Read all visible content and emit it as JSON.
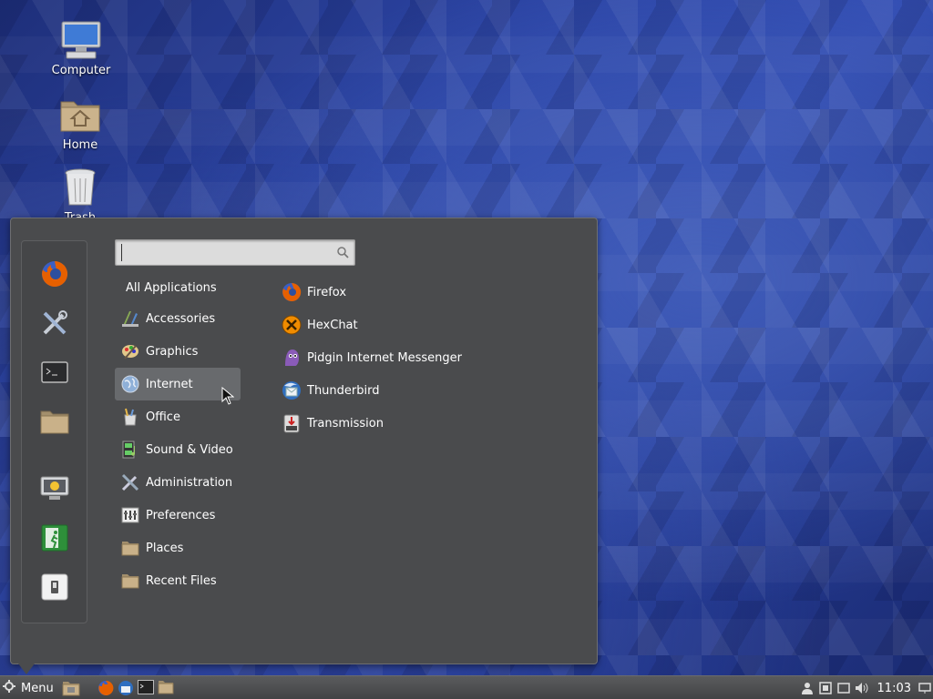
{
  "desktop": {
    "icons": [
      {
        "label": "Computer",
        "icon": "computer-icon"
      },
      {
        "label": "Home",
        "icon": "home-folder-icon"
      },
      {
        "label": "Trash",
        "icon": "trash-icon"
      }
    ]
  },
  "menu": {
    "search": {
      "placeholder": "",
      "value": ""
    },
    "favorites": [
      "firefox-icon",
      "system-settings-icon",
      "terminal-icon",
      "files-icon",
      "lock-screen-icon",
      "logout-icon",
      "shutdown-icon"
    ],
    "all_applications_label": "All Applications",
    "categories": [
      {
        "label": "Accessories",
        "icon": "accessories-icon"
      },
      {
        "label": "Graphics",
        "icon": "graphics-icon"
      },
      {
        "label": "Internet",
        "icon": "internet-icon",
        "selected": true
      },
      {
        "label": "Office",
        "icon": "office-icon"
      },
      {
        "label": "Sound & Video",
        "icon": "sound-video-icon"
      },
      {
        "label": "Administration",
        "icon": "administration-icon"
      },
      {
        "label": "Preferences",
        "icon": "preferences-icon"
      },
      {
        "label": "Places",
        "icon": "folder-icon"
      },
      {
        "label": "Recent Files",
        "icon": "folder-icon"
      }
    ],
    "apps": [
      {
        "label": "Firefox",
        "icon": "firefox-icon"
      },
      {
        "label": "HexChat",
        "icon": "hexchat-icon"
      },
      {
        "label": "Pidgin Internet Messenger",
        "icon": "pidgin-icon"
      },
      {
        "label": "Thunderbird",
        "icon": "thunderbird-icon"
      },
      {
        "label": "Transmission",
        "icon": "transmission-icon"
      }
    ]
  },
  "taskbar": {
    "menu_label": "Menu",
    "clock": "11:03",
    "colors": {
      "accent": "#686a6d",
      "panel": "#4a4b4d"
    }
  }
}
